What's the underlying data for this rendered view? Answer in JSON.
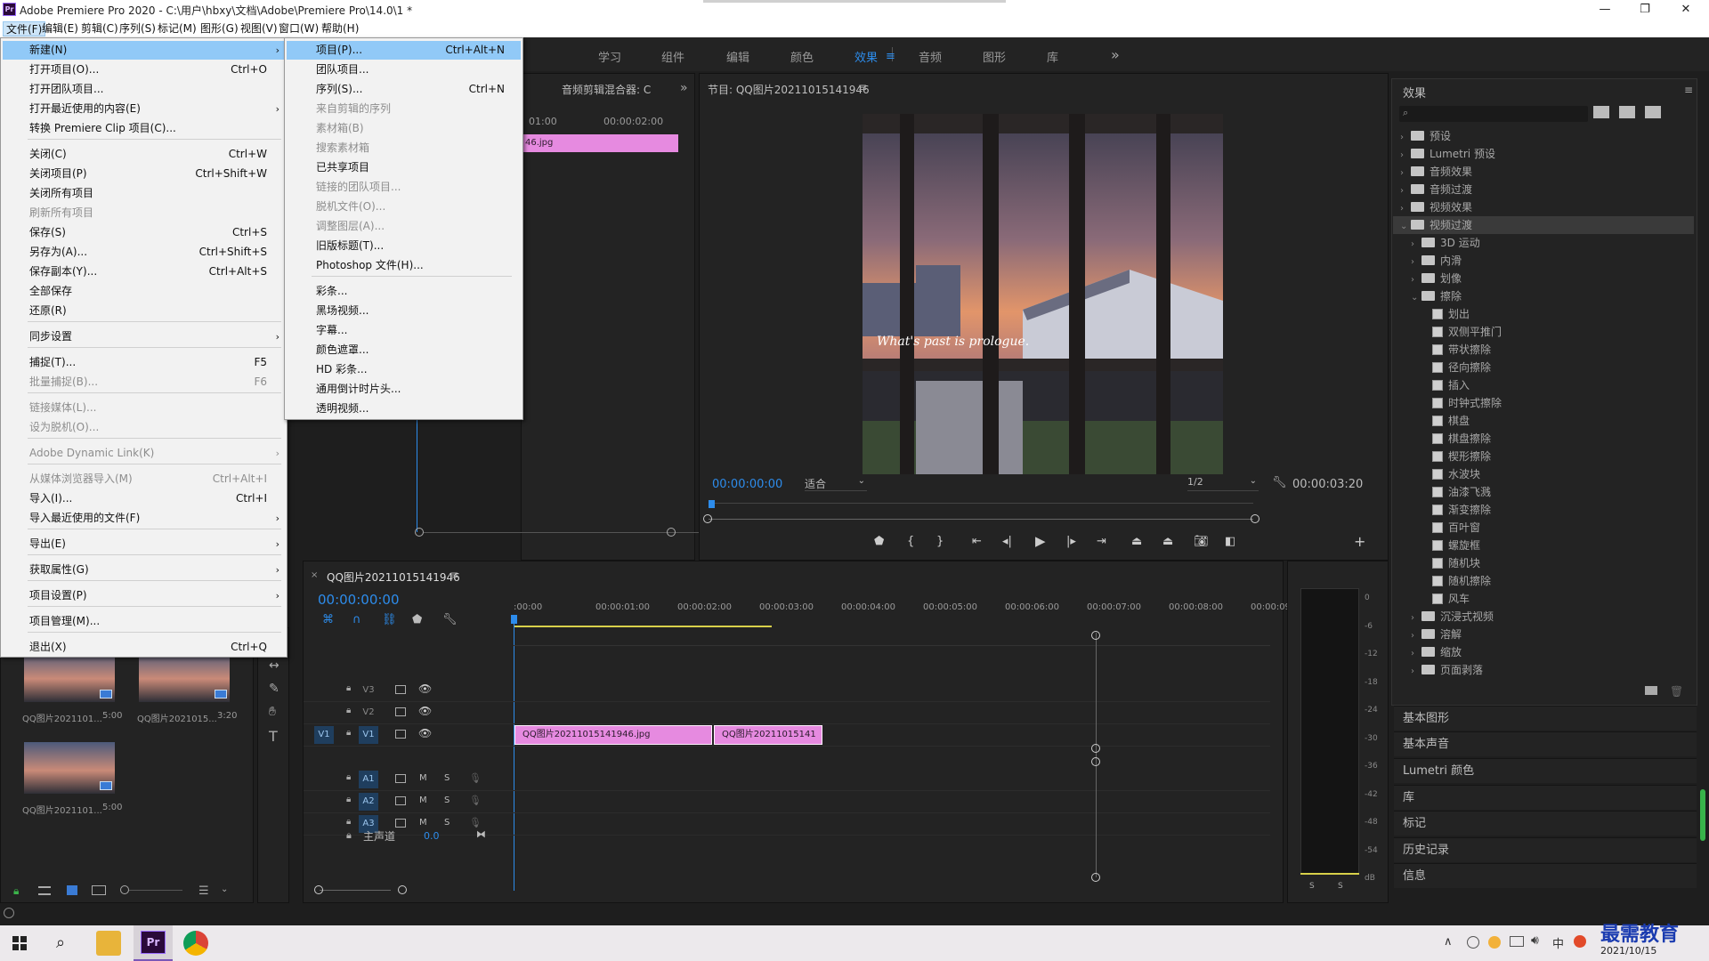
{
  "window": {
    "title": "Adobe Premiere Pro 2020 - C:\\用户\\hbxy\\文档\\Adobe\\Premiere Pro\\14.0\\1 *",
    "app_icon": "Pr",
    "minimize": "—",
    "restore": "❐",
    "close": "✕"
  },
  "menubar": [
    {
      "label": "文件(F)",
      "selected": true
    },
    {
      "label": "编辑(E)"
    },
    {
      "label": "剪辑(C)"
    },
    {
      "label": "序列(S)"
    },
    {
      "label": "标记(M)"
    },
    {
      "label": "图形(G)"
    },
    {
      "label": "视图(V)"
    },
    {
      "label": "窗口(W)"
    },
    {
      "label": "帮助(H)"
    }
  ],
  "workspaces": [
    {
      "label": "学习"
    },
    {
      "label": "组件"
    },
    {
      "label": "编辑"
    },
    {
      "label": "颜色"
    },
    {
      "label": "效果",
      "active": true
    },
    {
      "label": "音频"
    },
    {
      "label": "图形"
    },
    {
      "label": "库"
    }
  ],
  "workspaces_more": "»",
  "file_menu": [
    {
      "label": "新建(N)",
      "arrow": true,
      "highlight": true
    },
    {
      "label": "打开项目(O)...",
      "shortcut": "Ctrl+O"
    },
    {
      "label": "打开团队项目..."
    },
    {
      "label": "打开最近使用的内容(E)",
      "arrow": true
    },
    {
      "label": "转换 Premiere Clip 项目(C)...",
      "sep_after": true
    },
    {
      "label": "关闭(C)",
      "shortcut": "Ctrl+W"
    },
    {
      "label": "关闭项目(P)",
      "shortcut": "Ctrl+Shift+W"
    },
    {
      "label": "关闭所有项目"
    },
    {
      "label": "刷新所有项目",
      "disabled": true
    },
    {
      "label": "保存(S)",
      "shortcut": "Ctrl+S"
    },
    {
      "label": "另存为(A)...",
      "shortcut": "Ctrl+Shift+S"
    },
    {
      "label": "保存副本(Y)...",
      "shortcut": "Ctrl+Alt+S"
    },
    {
      "label": "全部保存"
    },
    {
      "label": "还原(R)",
      "sep_after": true
    },
    {
      "label": "同步设置",
      "arrow": true,
      "sep_after": true
    },
    {
      "label": "捕捉(T)...",
      "shortcut": "F5"
    },
    {
      "label": "批量捕捉(B)...",
      "shortcut": "F6",
      "disabled": true,
      "sep_after": true
    },
    {
      "label": "链接媒体(L)...",
      "disabled": true
    },
    {
      "label": "设为脱机(O)...",
      "disabled": true,
      "sep_after": true
    },
    {
      "label": "Adobe Dynamic Link(K)",
      "arrow": true,
      "disabled": true,
      "sep_after": true
    },
    {
      "label": "从媒体浏览器导入(M)",
      "shortcut": "Ctrl+Alt+I",
      "disabled": true
    },
    {
      "label": "导入(I)...",
      "shortcut": "Ctrl+I"
    },
    {
      "label": "导入最近使用的文件(F)",
      "arrow": true,
      "sep_after": true
    },
    {
      "label": "导出(E)",
      "arrow": true,
      "sep_after": true
    },
    {
      "label": "获取属性(G)",
      "arrow": true,
      "sep_after": true
    },
    {
      "label": "项目设置(P)",
      "arrow": true,
      "sep_after": true
    },
    {
      "label": "项目管理(M)...",
      "sep_after": true
    },
    {
      "label": "退出(X)",
      "shortcut": "Ctrl+Q"
    }
  ],
  "new_submenu": [
    {
      "label": "项目(P)...",
      "shortcut": "Ctrl+Alt+N",
      "highlight": true
    },
    {
      "label": "团队项目..."
    },
    {
      "label": "序列(S)...",
      "shortcut": "Ctrl+N"
    },
    {
      "label": "来自剪辑的序列",
      "disabled": true
    },
    {
      "label": "素材箱(B)",
      "disabled": true
    },
    {
      "label": "搜索素材箱",
      "disabled": true
    },
    {
      "label": "已共享项目"
    },
    {
      "label": "链接的团队项目...",
      "disabled": true
    },
    {
      "label": "脱机文件(O)...",
      "disabled": true
    },
    {
      "label": "调整图层(A)...",
      "disabled": true
    },
    {
      "label": "旧版标题(T)..."
    },
    {
      "label": "Photoshop 文件(H)...",
      "sep_after": true
    },
    {
      "label": "彩条..."
    },
    {
      "label": "黑场视频..."
    },
    {
      "label": "字幕..."
    },
    {
      "label": "颜色遮罩..."
    },
    {
      "label": "HD 彩条..."
    },
    {
      "label": "通用倒计时片头..."
    },
    {
      "label": "透明视频..."
    }
  ],
  "source_panel": {
    "tab": "音频剪辑混合器: C",
    "time1": "01:00",
    "time2": "00:00:02:00",
    "clip": "46.jpg"
  },
  "program_monitor": {
    "title": "节目: QQ图片20211015141946",
    "overlay_text": "What's past is prologue.",
    "current_time": "00:00:00:00",
    "fit": "适合",
    "resolution": "1/2",
    "duration": "00:00:03:20"
  },
  "effects_panel": {
    "title": "效果",
    "search_placeholder": "",
    "tree": [
      {
        "label": "预设",
        "type": "folder",
        "level": 0
      },
      {
        "label": "Lumetri 预设",
        "type": "folder",
        "level": 0
      },
      {
        "label": "音频效果",
        "type": "folder",
        "level": 0
      },
      {
        "label": "音频过渡",
        "type": "folder",
        "level": 0
      },
      {
        "label": "视频效果",
        "type": "folder",
        "level": 0
      },
      {
        "label": "视频过渡",
        "type": "folder",
        "level": 0,
        "open": true,
        "selected": true
      },
      {
        "label": "3D 运动",
        "type": "folder",
        "level": 1
      },
      {
        "label": "内滑",
        "type": "folder",
        "level": 1
      },
      {
        "label": "划像",
        "type": "folder",
        "level": 1
      },
      {
        "label": "擦除",
        "type": "folder",
        "level": 1,
        "open": true
      },
      {
        "label": "划出",
        "type": "fx",
        "level": 2
      },
      {
        "label": "双侧平推门",
        "type": "fx",
        "level": 2
      },
      {
        "label": "带状擦除",
        "type": "fx",
        "level": 2
      },
      {
        "label": "径向擦除",
        "type": "fx",
        "level": 2
      },
      {
        "label": "插入",
        "type": "fx",
        "level": 2
      },
      {
        "label": "时钟式擦除",
        "type": "fx",
        "level": 2
      },
      {
        "label": "棋盘",
        "type": "fx",
        "level": 2
      },
      {
        "label": "棋盘擦除",
        "type": "fx",
        "level": 2
      },
      {
        "label": "楔形擦除",
        "type": "fx",
        "level": 2
      },
      {
        "label": "水波块",
        "type": "fx",
        "level": 2
      },
      {
        "label": "油漆飞溅",
        "type": "fx",
        "level": 2
      },
      {
        "label": "渐变擦除",
        "type": "fx",
        "level": 2
      },
      {
        "label": "百叶窗",
        "type": "fx",
        "level": 2
      },
      {
        "label": "螺旋框",
        "type": "fx",
        "level": 2
      },
      {
        "label": "随机块",
        "type": "fx",
        "level": 2
      },
      {
        "label": "随机擦除",
        "type": "fx",
        "level": 2
      },
      {
        "label": "风车",
        "type": "fx",
        "level": 2
      },
      {
        "label": "沉浸式视频",
        "type": "folder",
        "level": 1
      },
      {
        "label": "溶解",
        "type": "folder",
        "level": 1
      },
      {
        "label": "缩放",
        "type": "folder",
        "level": 1
      },
      {
        "label": "页面剥落",
        "type": "folder",
        "level": 1
      }
    ]
  },
  "side_panels": [
    "基本图形",
    "基本声音",
    "Lumetri 颜色",
    "库",
    "标记",
    "历史记录",
    "信息"
  ],
  "project_panel": {
    "items": [
      {
        "name": "QQ图片2021101...",
        "duration": "5:00"
      },
      {
        "name": "QQ图片2021015...",
        "duration": "3:20"
      },
      {
        "name": "QQ图片2021101...",
        "duration": "5:00"
      }
    ]
  },
  "timeline": {
    "tab": "QQ图片20211015141946",
    "current_time": "00:00:00:00",
    "ruler": [
      ":00:00",
      "00:00:01:00",
      "00:00:02:00",
      "00:00:03:00",
      "00:00:04:00",
      "00:00:05:00",
      "00:00:06:00",
      "00:00:07:00",
      "00:00:08:00",
      "00:00:09:"
    ],
    "video_tracks": [
      "V3",
      "V2",
      "V1"
    ],
    "audio_tracks": [
      "A1",
      "A2",
      "A3"
    ],
    "source_patch_v": "V1",
    "master": "主声道",
    "master_value": "0.0",
    "clips": [
      {
        "label": "QQ图片20211015141946.jpg"
      },
      {
        "label": "QQ图片20211015141"
      }
    ],
    "track_m": "M",
    "track_s": "S"
  },
  "audio_meter": {
    "db_labels": [
      "0",
      "-6",
      "-12",
      "-18",
      "-24",
      "-30",
      "-36",
      "-42",
      "-48",
      "-54",
      "dB"
    ],
    "solo_l": "S",
    "solo_r": "S"
  },
  "taskbar": {
    "date": "2021/10/15",
    "ime": "中",
    "watermark": "最需教育"
  },
  "colors": {
    "accent_blue": "#2d8ceb",
    "clip_pink": "#e68ae0",
    "menu_highlight": "#91c9f7"
  }
}
